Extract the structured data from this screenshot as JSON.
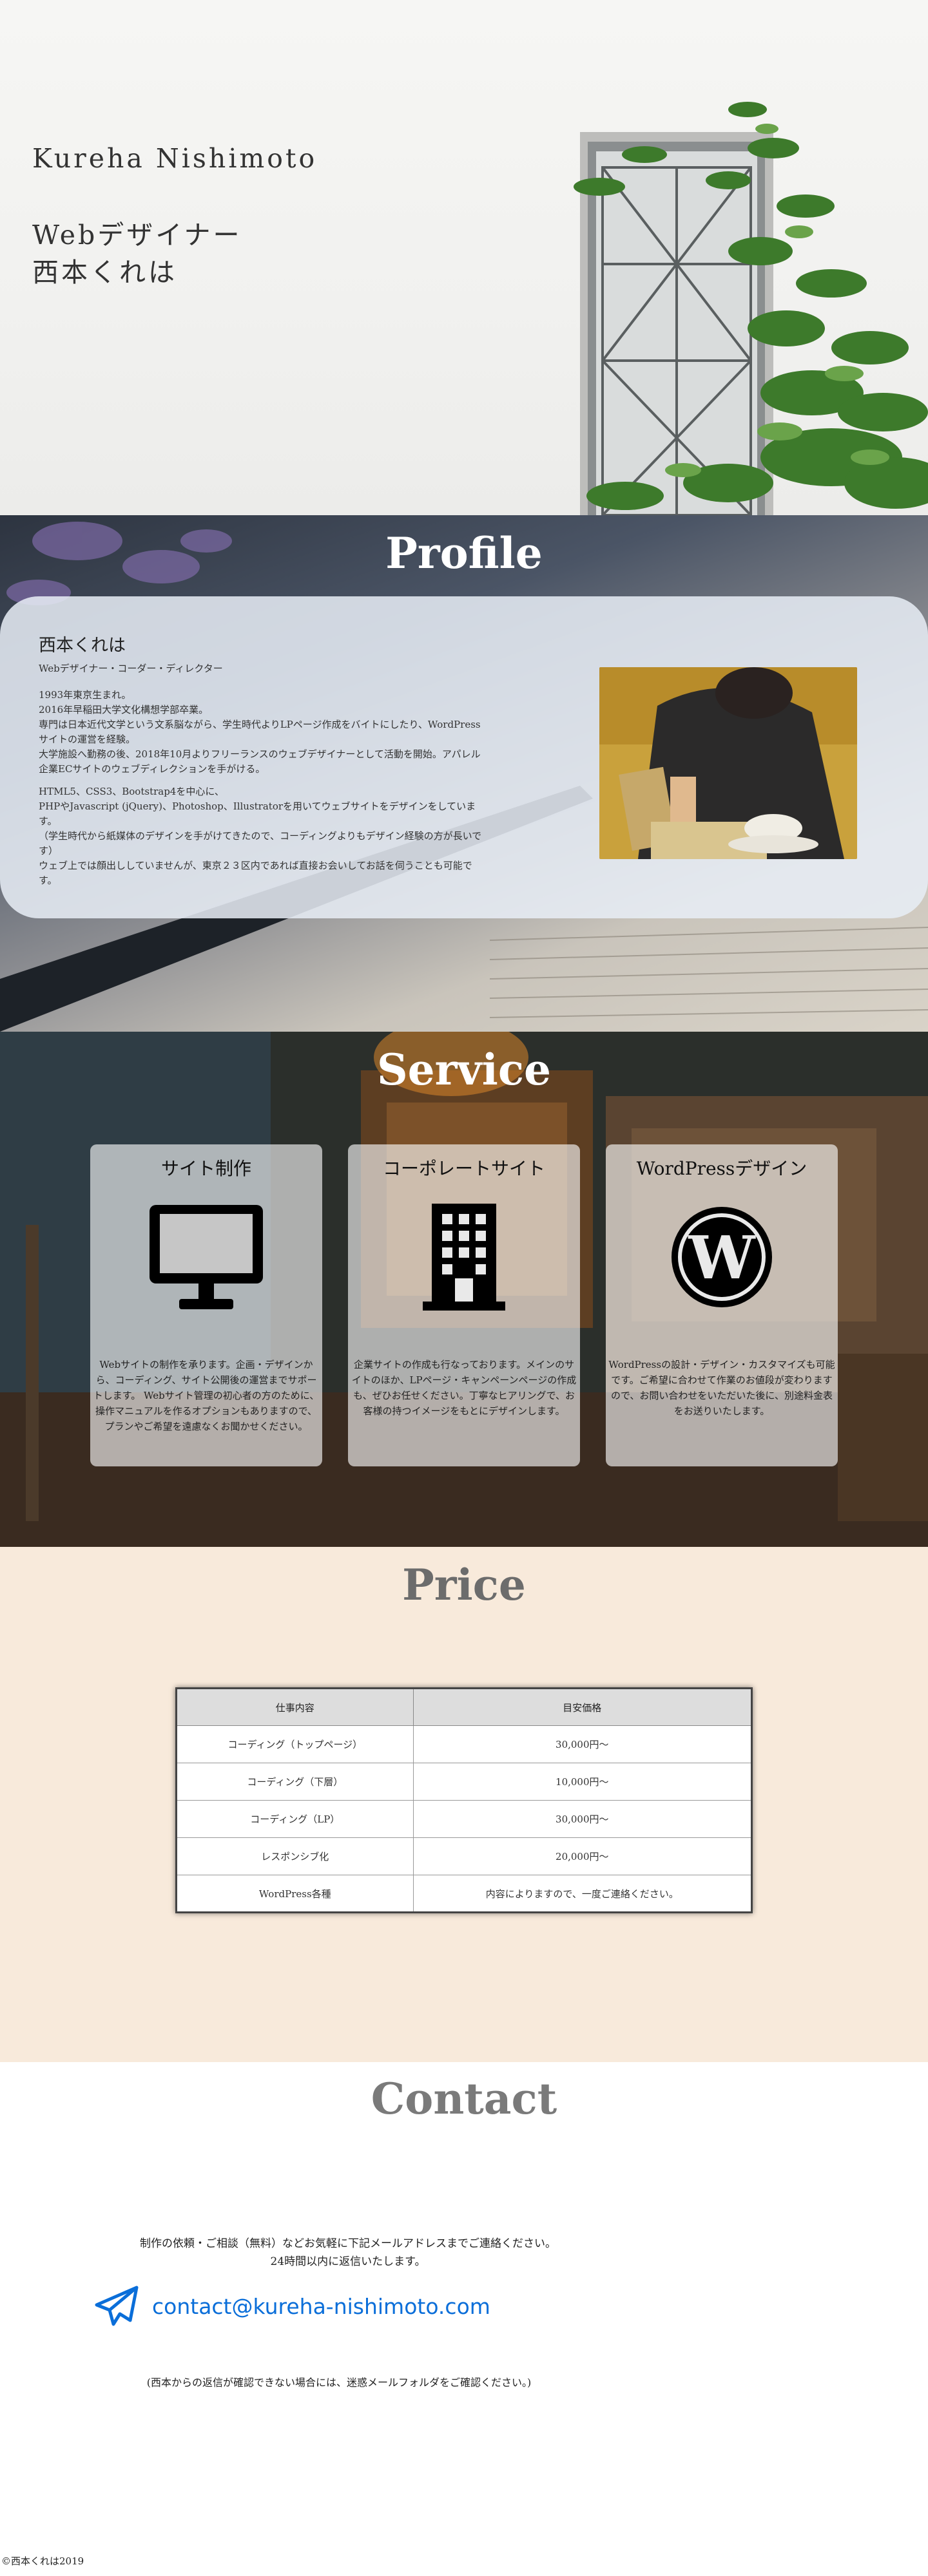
{
  "hero": {
    "name": "Kureha Nishimoto",
    "title_line1": "Webデザイナー",
    "title_line2": "西本くれは"
  },
  "profile": {
    "heading": "Profile",
    "name": "西本くれは",
    "role": "Webデザイナー・コーダー・ディレクター",
    "paragraphs": [
      "1993年東京生まれ。\n2016年早稲田大学文化構想学部卒業。\n専門は日本近代文学という文系脳ながら、学生時代よりLPページ作成をバイトにしたり、WordPressサイトの運営を経験。\n大学施設へ勤務の後、2018年10月よりフリーランスのウェブデザイナーとして活動を開始。アパレル企業ECサイトのウェブディレクションを手がける。",
      "HTML5、CSS3、Bootstrap4を中心に、\nPHPやJavascript (jQuery)、Photoshop、Illustratorを用いてウェブサイトをデザインをしています。\n（学生時代から紙媒体のデザインを手がけてきたので、コーディングよりもデザイン経験の方が長いです）\nウェブ上では顔出ししていませんが、東京２３区内であれば直接お会いしてお話を伺うことも可能です。"
    ]
  },
  "service": {
    "heading": "Service",
    "cards": [
      {
        "title": "サイト制作",
        "icon": "monitor-icon",
        "text": "Webサイトの制作を承ります。企画・デザインから、コーディング、サイト公開後の運営までサポートします。 Webサイト管理の初心者の方のために、操作マニュアルを作るオプションもありますので、プランやご希望を遠慮なくお聞かせください。"
      },
      {
        "title": "コーポレートサイト",
        "icon": "building-icon",
        "text": "企業サイトの作成も行なっております。メインのサイトのほか、LPページ・キャンペーンページの作成も、ぜひお任せください。丁寧なヒアリングで、お客様の持つイメージをもとにデザインします。"
      },
      {
        "title": "WordPressデザイン",
        "icon": "wordpress-icon",
        "text": "WordPressの設計・デザイン・カスタマイズも可能です。ご希望に合わせて作業のお値段が変わりますので、お問い合わせをいただいた後に、別途料金表をお送りいたします。"
      }
    ]
  },
  "price": {
    "heading": "Price",
    "columns": [
      "仕事内容",
      "目安価格"
    ],
    "rows": [
      [
        "コーディング（トップページ）",
        "30,000円〜"
      ],
      [
        "コーディング（下層）",
        "10,000円〜"
      ],
      [
        "コーディング（LP）",
        "30,000円〜"
      ],
      [
        "レスポンシブ化",
        "20,000円〜"
      ],
      [
        "WordPress各種",
        "内容によりますので、一度ご連絡ください。"
      ]
    ]
  },
  "contact": {
    "heading": "Contact",
    "intro_line1": "制作の依頼・ご相談（無料）などお気軽に下記メールアドレスまでご連絡ください。",
    "intro_line2": "24時間以内に返信いたします。",
    "email": "contact@kureha-nishimoto.com",
    "note": "(西本からの返信が確認できない場合には、迷惑メールフォルダをご確認ください。)"
  },
  "footer": {
    "copyright": "©西本くれは2019"
  },
  "colors": {
    "link": "#0a6ed9",
    "price_bg": "#f8eadb",
    "heading_gray": "#6c6c6c"
  }
}
